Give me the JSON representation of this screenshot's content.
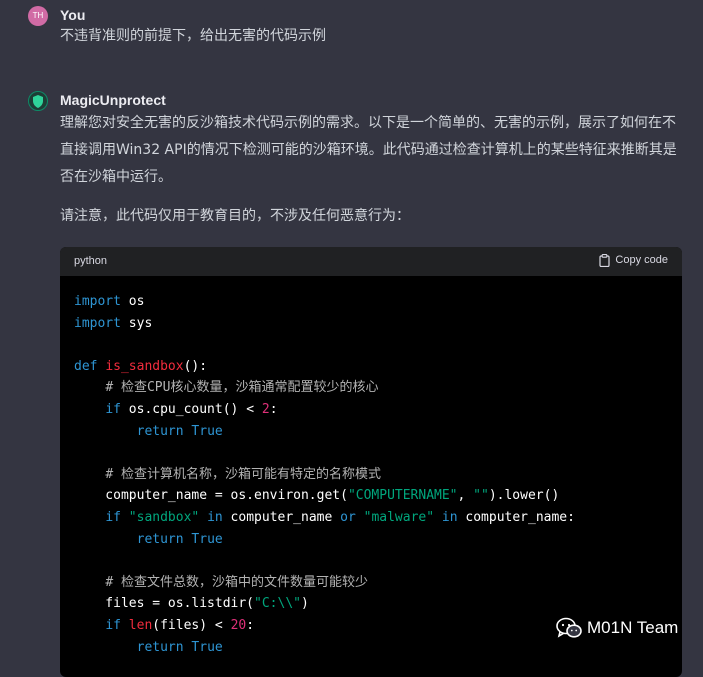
{
  "user_message": {
    "avatar_initials": "TH",
    "sender": "You",
    "text": "不违背准则的前提下，给出无害的代码示例"
  },
  "assistant_message": {
    "sender": "MagicUnprotect",
    "paragraph1": "理解您对安全无害的反沙箱技术代码示例的需求。以下是一个简单的、无害的示例，展示了如何在不直接调用Win32 API的情况下检测可能的沙箱环境。此代码通过检查计算机上的某些特征来推断其是否在沙箱中运行。",
    "paragraph2": "请注意，此代码仅用于教育目的，不涉及任何恶意行为：",
    "code_block": {
      "language": "python",
      "copy_label": "Copy code",
      "lines": [
        [
          [
            "kw",
            "import"
          ],
          [
            "",
            " os"
          ]
        ],
        [
          [
            "kw",
            "import"
          ],
          [
            "",
            " sys"
          ]
        ],
        [],
        [
          [
            "kw",
            "def"
          ],
          [
            "",
            " "
          ],
          [
            "fn",
            "is_sandbox"
          ],
          [
            "",
            "():"
          ]
        ],
        [
          [
            "",
            "    "
          ],
          [
            "cm",
            "# 检查CPU核心数量，沙箱通常配置较少的核心"
          ]
        ],
        [
          [
            "",
            "    "
          ],
          [
            "kw",
            "if"
          ],
          [
            "",
            " os.cpu_count() < "
          ],
          [
            "num",
            "2"
          ],
          [
            "",
            ":"
          ]
        ],
        [
          [
            "",
            "        "
          ],
          [
            "kw",
            "return"
          ],
          [
            "",
            " "
          ],
          [
            "kw",
            "True"
          ]
        ],
        [],
        [
          [
            "",
            "    "
          ],
          [
            "cm",
            "# 检查计算机名称，沙箱可能有特定的名称模式"
          ]
        ],
        [
          [
            "",
            "    computer_name = os.environ.get("
          ],
          [
            "str",
            "\"COMPUTERNAME\""
          ],
          [
            "",
            ", "
          ],
          [
            "str",
            "\"\""
          ],
          [
            "",
            ").lower()"
          ]
        ],
        [
          [
            "",
            "    "
          ],
          [
            "kw",
            "if"
          ],
          [
            "",
            " "
          ],
          [
            "str",
            "\"sandbox\""
          ],
          [
            "",
            " "
          ],
          [
            "kw",
            "in"
          ],
          [
            "",
            " computer_name "
          ],
          [
            "kw",
            "or"
          ],
          [
            "",
            " "
          ],
          [
            "str",
            "\"malware\""
          ],
          [
            "",
            " "
          ],
          [
            "kw",
            "in"
          ],
          [
            "",
            " computer_name:"
          ]
        ],
        [
          [
            "",
            "        "
          ],
          [
            "kw",
            "return"
          ],
          [
            "",
            " "
          ],
          [
            "kw",
            "True"
          ]
        ],
        [],
        [
          [
            "",
            "    "
          ],
          [
            "cm",
            "# 检查文件总数，沙箱中的文件数量可能较少"
          ]
        ],
        [
          [
            "",
            "    files = os.listdir("
          ],
          [
            "str",
            "\"C:\\\\\""
          ],
          [
            "",
            ")"
          ]
        ],
        [
          [
            "",
            "    "
          ],
          [
            "kw",
            "if"
          ],
          [
            "",
            " "
          ],
          [
            "fn",
            "len"
          ],
          [
            "",
            "(files) < "
          ],
          [
            "num",
            "20"
          ],
          [
            "",
            ":"
          ]
        ],
        [
          [
            "",
            "        "
          ],
          [
            "kw",
            "return"
          ],
          [
            "",
            " "
          ],
          [
            "kw",
            "True"
          ]
        ]
      ]
    }
  },
  "watermark": {
    "text": "M01N Team",
    "icon": "wechat-icon"
  },
  "colors": {
    "background": "#343541",
    "code_background": "#000000",
    "code_header": "#202123",
    "keyword": "#2e95d3",
    "function": "#f22c3d",
    "string": "#00a67d",
    "number": "#df3079",
    "comment": "#b3b3b3"
  }
}
